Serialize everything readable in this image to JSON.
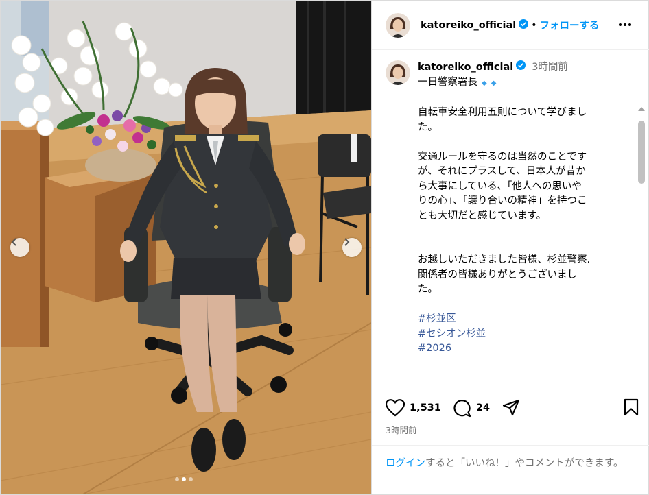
{
  "post": {
    "username": "katoreiko_official",
    "follow_label": "フォローする",
    "separator": "•",
    "time_ago": "3時間前"
  },
  "caption": {
    "lines": [
      "一日警察署長",
      "自転車安全利用五則について学びまし",
      "た。",
      "交通ルールを守るのは当然のことです",
      "が、それにプラスして、日本人が昔か",
      "ら大事にしている、「他人への思いや",
      "りの心」、「譲り合いの精神」を持つこ",
      "とも大切だと感じています。",
      "お越しいただきました皆様、杉並警察.",
      "関係者の皆様ありがとうございまし",
      "た。"
    ],
    "hashtags": [
      "#杉並区",
      "#セシオン杉並",
      "#2026"
    ]
  },
  "actions": {
    "likes": "1,531",
    "comments": "24"
  },
  "timestamp": "3時間前",
  "footer": {
    "login_link": "ログイン",
    "login_rest": "すると「いいね！」やコメントができます。"
  },
  "colors": {
    "accent": "#0095f6",
    "verified": "#0095f6",
    "muted": "#737373",
    "hashtag": "#385898"
  },
  "icons": {
    "like": "heart-icon",
    "comment": "comment-icon",
    "share": "paper-plane-icon",
    "save": "bookmark-icon",
    "more": "more-horizontal-icon",
    "prev": "chevron-left-icon",
    "next": "chevron-right-icon"
  },
  "carousel": {
    "slides": 3,
    "active_index": 1
  }
}
